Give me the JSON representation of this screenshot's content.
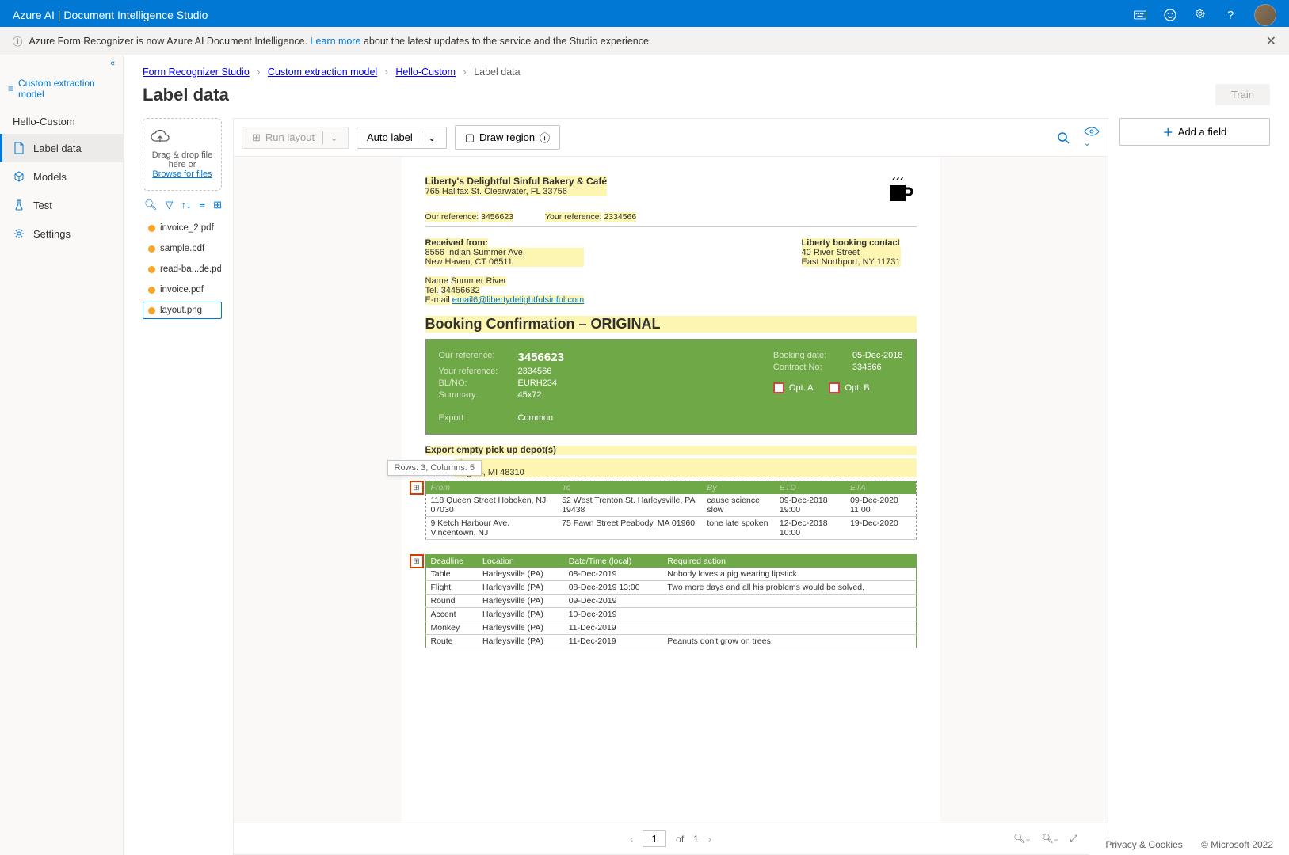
{
  "header": {
    "title": "Azure AI | Document Intelligence Studio"
  },
  "banner": {
    "text_before": "Azure Form Recognizer is now Azure AI Document Intelligence. ",
    "link": "Learn more",
    "text_after": " about the latest updates to the service and the Studio experience."
  },
  "sidebar": {
    "header": "Custom extraction model",
    "project": "Hello-Custom",
    "items": [
      {
        "label": "Label data",
        "icon": "document-icon"
      },
      {
        "label": "Models",
        "icon": "cube-icon"
      },
      {
        "label": "Test",
        "icon": "flask-icon"
      },
      {
        "label": "Settings",
        "icon": "gear-icon"
      }
    ]
  },
  "breadcrumb": {
    "items": [
      "Form Recognizer Studio",
      "Custom extraction model",
      "Hello-Custom"
    ],
    "current": "Label data"
  },
  "page_title": "Label data",
  "train_btn": "Train",
  "dropzone": {
    "line1": "Drag & drop file here or",
    "link": "Browse for files"
  },
  "files": [
    {
      "name": "invoice_2.pdf"
    },
    {
      "name": "sample.pdf"
    },
    {
      "name": "read-ba...de.pdf"
    },
    {
      "name": "invoice.pdf"
    },
    {
      "name": "layout.png"
    }
  ],
  "toolbar": {
    "run_layout": "Run layout",
    "auto_label": "Auto label",
    "draw_region": "Draw region"
  },
  "tooltip": "Rows: 3, Columns: 5",
  "document": {
    "company": "Liberty's Delightful Sinful Bakery & Café",
    "address": "765 Halifax St. Clearwater, FL 33756",
    "our_ref_label": "Our reference:",
    "our_ref": "3456623",
    "your_ref_label": "Your reference:",
    "your_ref": "2334566",
    "received_from_label": "Received from:",
    "received_addr1": "8556 Indian Summer Ave.",
    "received_addr2": "New Haven, CT 06511",
    "contact_name_label": "Name",
    "contact_name": "Summer River",
    "tel_label": "Tel.",
    "tel": "34456632",
    "email_label": "E-mail",
    "email": "email6@libertydelightfulsinful.com",
    "booking_contact_label": "Liberty booking contact",
    "booking_addr1": "40 River Street",
    "booking_addr2": "East Northport, NY 11731",
    "section_title": "Booking Confirmation – ORIGINAL",
    "green": {
      "our_ref_l": "Our reference:",
      "our_ref_v": "3456623",
      "your_ref_l": "Your reference:",
      "your_ref_v": "2334566",
      "blno_l": "BL/NO:",
      "blno_v": "EURH234",
      "summary_l": "Summary:",
      "summary_v": "45x72",
      "export_l": "Export:",
      "export_v": "Common",
      "booking_date_l": "Booking date:",
      "booking_date_v": "05-Dec-2018",
      "contract_l": "Contract No:",
      "contract_v": "334566",
      "opt_a": "Opt. A",
      "opt_b": "Opt. B"
    },
    "depot_label": "Export empty pick up depot(s)",
    "depot_addr1": "s Lane",
    "depot_addr2": "Heights, MI 48310",
    "table1": {
      "headers": [
        "From",
        "To",
        "By",
        "ETD",
        "ETA"
      ],
      "rows": [
        [
          "118 Queen Street Hoboken, NJ 07030",
          "52 West Trenton St. Harleysville, PA 19438",
          "cause science slow",
          "09-Dec-2018 19:00",
          "09-Dec-2020 11:00"
        ],
        [
          "9 Ketch Harbour Ave. Vincentown, NJ",
          "75 Fawn Street Peabody, MA 01960",
          "tone late spoken",
          "12-Dec-2018 10:00",
          "19-Dec-2020"
        ]
      ]
    },
    "table2": {
      "headers": [
        "Deadline",
        "Location",
        "Date/Time (local)",
        "Required action"
      ],
      "rows": [
        [
          "Table",
          "Harleysville (PA)",
          "08-Dec-2019",
          "Nobody loves a pig wearing lipstick."
        ],
        [
          "Flight",
          "Harleysville (PA)",
          "08-Dec-2019 13:00",
          "Two more days and all his problems would be solved."
        ],
        [
          "Round",
          "Harleysville (PA)",
          "09-Dec-2019",
          ""
        ],
        [
          "Accent",
          "Harleysville (PA)",
          "10-Dec-2019",
          ""
        ],
        [
          "Monkey",
          "Harleysville (PA)",
          "11-Dec-2019",
          ""
        ],
        [
          "Route",
          "Harleysville (PA)",
          "11-Dec-2019",
          "Peanuts don't grow on trees."
        ]
      ]
    }
  },
  "pager": {
    "page": "1",
    "of": "of",
    "total": "1"
  },
  "fields": {
    "add_label": "Add a field"
  },
  "footer": {
    "privacy": "Privacy & Cookies",
    "copyright": "© Microsoft 2022"
  }
}
